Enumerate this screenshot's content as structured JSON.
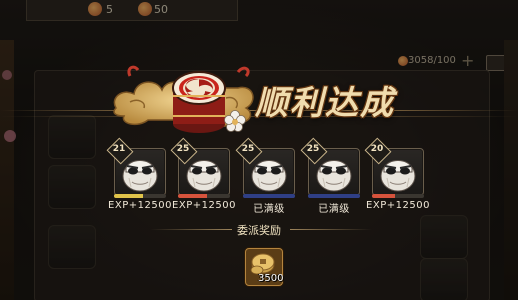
{
  "top_resources": {
    "res1_value": "5",
    "res2_value": "50",
    "energy": "3058/100"
  },
  "result": {
    "title": "顺利达成"
  },
  "shikigami": [
    {
      "level": "21",
      "label": "EXP+12500",
      "bar_fill": 0.55,
      "bar_color": "#e0c34a"
    },
    {
      "level": "25",
      "label": "EXP+12500",
      "bar_fill": 0.55,
      "bar_color": "#d6533c"
    },
    {
      "level": "25",
      "label": "已满级",
      "bar_fill": 1.0,
      "bar_color": "#2f3f86"
    },
    {
      "level": "25",
      "label": "已满级",
      "bar_fill": 1.0,
      "bar_color": "#2f3f86"
    },
    {
      "level": "20",
      "label": "EXP+12500",
      "bar_fill": 0.45,
      "bar_color": "#d6533c"
    }
  ],
  "reward": {
    "title": "委派奖励",
    "amount": "3500",
    "icon": "coin-icon"
  },
  "colors": {
    "gold": "#f0dcae",
    "panel_bg": "#1a1612"
  }
}
